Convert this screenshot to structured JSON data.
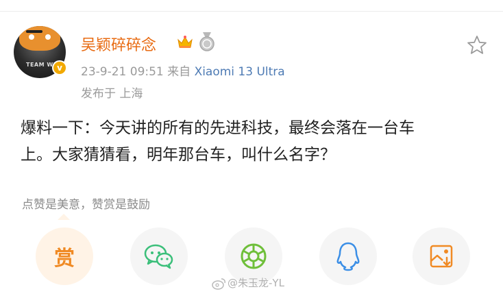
{
  "post": {
    "username": "吴颖碎碎念",
    "timestamp": "23-9-21 09:51",
    "source_prefix": "来自",
    "device": "Xiaomi 13 Ultra",
    "location": "发布于 上海",
    "text_line1": "爆料一下：今天讲的所有的先进科技，最终会落在一台车",
    "text_line2": "上。大家猜猜看，明年那台车，叫什么名字？"
  },
  "avatar": {
    "shirt_text": "TEAM WU",
    "verified_mark": "v"
  },
  "reward": {
    "tip": "点赞是美意，赞赏是鼓励",
    "button_label": "赏"
  },
  "share_buttons": [
    "wechat-icon",
    "wechat-moments-icon",
    "qq-icon",
    "save-image-icon"
  ],
  "watermark": "@朱玉龙-YL",
  "colors": {
    "username": "#e86b12",
    "device": "#4e7bb4",
    "wechat": "#3bbf7a",
    "moments": "#6fbf3a",
    "qq": "#3a8ee6",
    "save": "#f08a24",
    "verified": "#f2a900"
  }
}
